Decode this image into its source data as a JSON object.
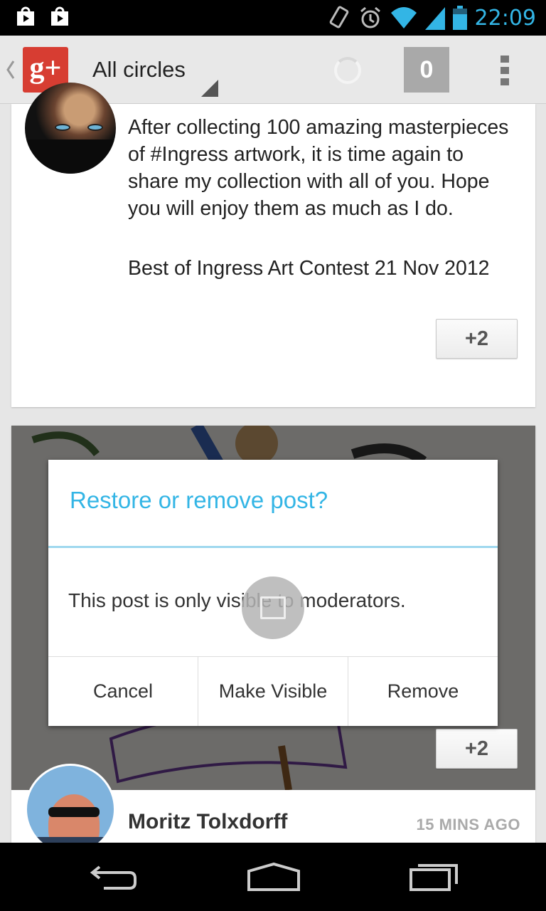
{
  "status_bar": {
    "time": "22:09",
    "icons": [
      "play-store-icon",
      "play-store-icon",
      "vibrate-icon",
      "alarm-icon",
      "wifi-icon",
      "signal-icon",
      "battery-icon"
    ]
  },
  "action_bar": {
    "app_icon": "google-plus-icon",
    "app_icon_text": "g+",
    "title": "All circles",
    "notification_count": "0"
  },
  "post1": {
    "text": "After collecting 100 amazing masterpieces of #Ingress  artwork, it is time again to share my collection with all of you. Hope you will enjoy them as much as I do.",
    "link_title": "Best of Ingress Art Contest 21 Nov 2012",
    "plus_label": "+2"
  },
  "post2": {
    "plus_label": "+2",
    "author": "Moritz Tolxdorff",
    "timestamp": "15 MINS AGO"
  },
  "dialog": {
    "title": "Restore or remove post?",
    "message": "This post is only visible to moderators.",
    "buttons": [
      "Cancel",
      "Make Visible",
      "Remove"
    ]
  },
  "colors": {
    "accent": "#33b5e5",
    "google_plus_red": "#d73d32"
  }
}
